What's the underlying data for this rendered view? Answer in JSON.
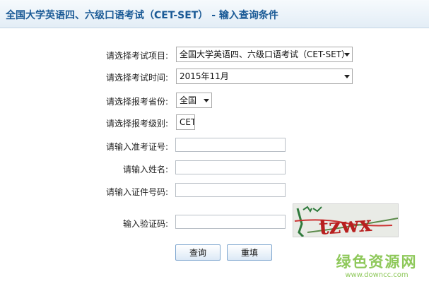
{
  "header": {
    "title": "全国大学英语四、六级口语考试（CET-SET） - 输入查询条件"
  },
  "form": {
    "exam_item": {
      "label": "请选择考试项目:",
      "value": "全国大学英语四、六级口语考试（CET-SET）"
    },
    "exam_time": {
      "label": "请选择考试时间:",
      "value": "2015年11月"
    },
    "province": {
      "label": "请选择报考省份:",
      "value": "全国"
    },
    "level": {
      "label": "请选择报考级别:",
      "value": "CET-SET"
    },
    "ticket_number": {
      "label": "请输入准考证号:",
      "value": "",
      "placeholder": ""
    },
    "name": {
      "label": "请输入姓名:",
      "value": "",
      "placeholder": ""
    },
    "id_number": {
      "label": "请输入证件号码:",
      "value": "",
      "placeholder": ""
    },
    "captcha": {
      "label": "输入验证码:",
      "value": "",
      "placeholder": "",
      "image_text": "tzwx"
    }
  },
  "buttons": {
    "query": "查询",
    "reset": "重填"
  },
  "watermark": {
    "main": "绿色资源网",
    "sub": "www.downcc.com"
  },
  "colors": {
    "title": "#1a5a96",
    "watermark": "#8ec85a",
    "button_border": "#7ea6cf"
  }
}
